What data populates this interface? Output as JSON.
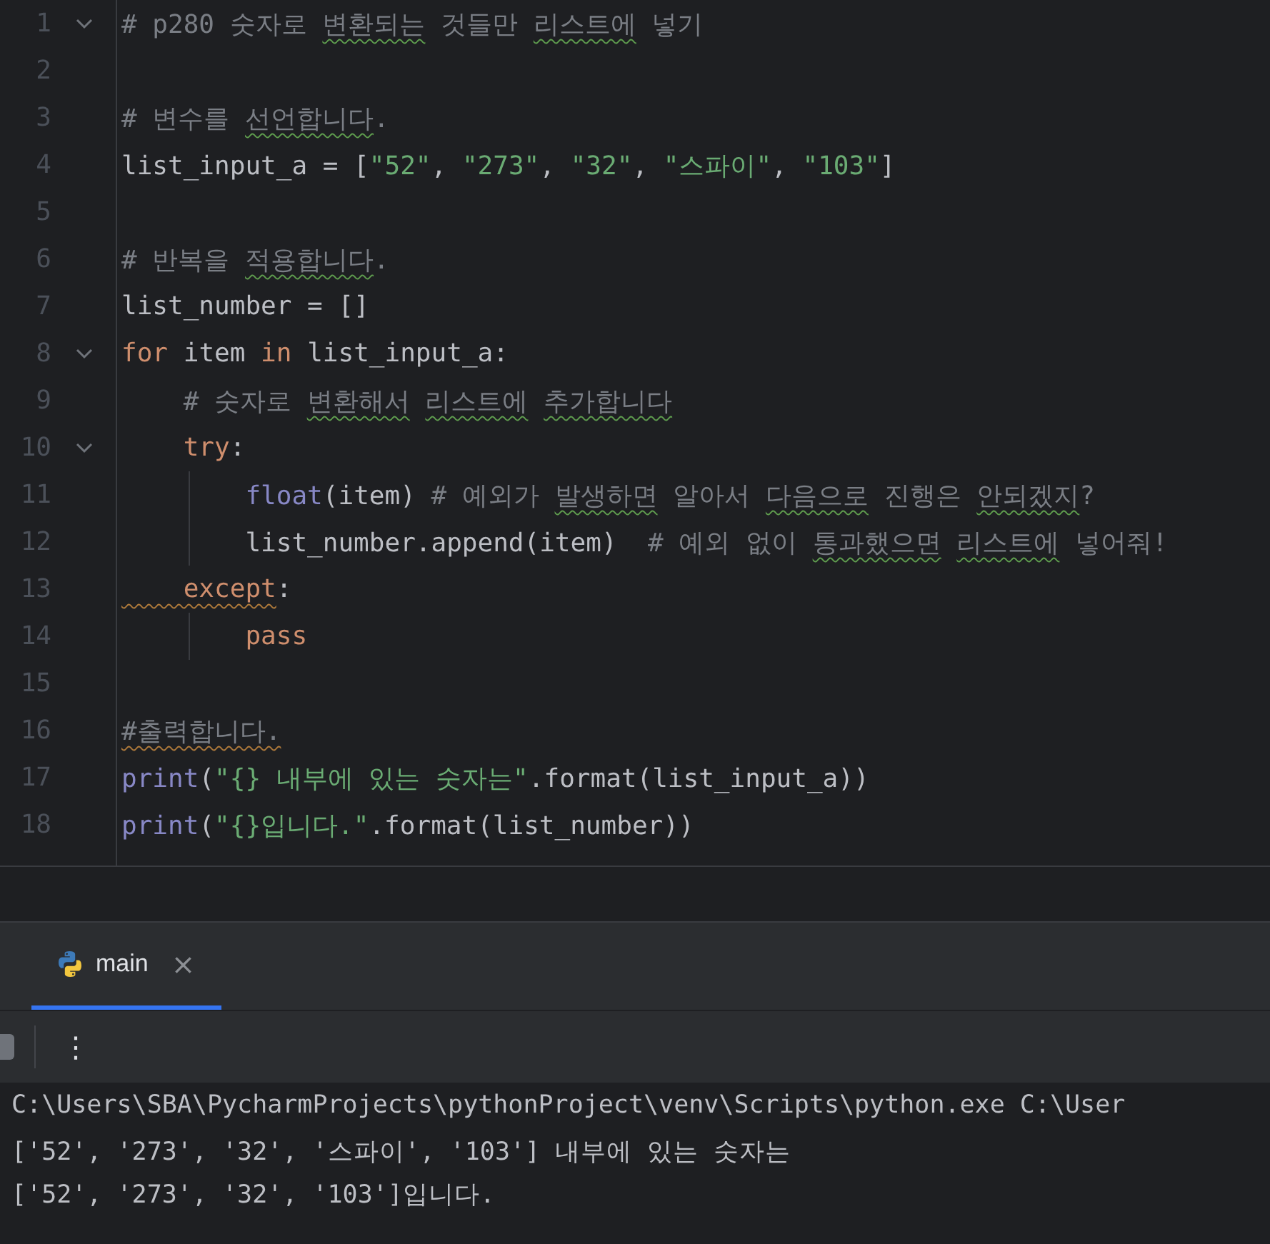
{
  "editor": {
    "lines": [
      {
        "number": "1",
        "fold": true,
        "tokens": [
          {
            "kind": "comment",
            "text": "# p280 숫자로 "
          },
          {
            "kind": "comment",
            "text": "변환되는 ",
            "typo": true
          },
          {
            "kind": "comment",
            "text": "것들만 "
          },
          {
            "kind": "comment",
            "text": "리스트에 ",
            "typo": true
          },
          {
            "kind": "comment",
            "text": "넣기"
          }
        ]
      },
      {
        "number": "2",
        "fold": false
      },
      {
        "number": "3",
        "fold": false,
        "tokens": [
          {
            "kind": "comment",
            "text": "# 변수를 "
          },
          {
            "kind": "comment",
            "text": "선언합니다",
            "typo": true
          },
          {
            "kind": "comment",
            "text": "."
          }
        ]
      },
      {
        "number": "4",
        "fold": false,
        "tokens": [
          {
            "kind": "plain",
            "text": "list_input_a = ["
          },
          {
            "kind": "string",
            "text": "\"52\""
          },
          {
            "kind": "plain",
            "text": ", "
          },
          {
            "kind": "string",
            "text": "\"273\""
          },
          {
            "kind": "plain",
            "text": ", "
          },
          {
            "kind": "string",
            "text": "\"32\""
          },
          {
            "kind": "plain",
            "text": ", "
          },
          {
            "kind": "string",
            "text": "\"스파이\""
          },
          {
            "kind": "plain",
            "text": ", "
          },
          {
            "kind": "string",
            "text": "\"103\""
          },
          {
            "kind": "plain",
            "text": "]"
          }
        ]
      },
      {
        "number": "5",
        "fold": false
      },
      {
        "number": "6",
        "fold": false,
        "tokens": [
          {
            "kind": "comment",
            "text": "# 반복을 "
          },
          {
            "kind": "comment",
            "text": "적용합니다",
            "typo": true
          },
          {
            "kind": "comment",
            "text": "."
          }
        ]
      },
      {
        "number": "7",
        "fold": false,
        "tokens": [
          {
            "kind": "plain",
            "text": "list_number = []"
          }
        ]
      },
      {
        "number": "8",
        "fold": true,
        "tokens": [
          {
            "kind": "keyword",
            "text": "for"
          },
          {
            "kind": "plain",
            "text": " item "
          },
          {
            "kind": "keyword",
            "text": "in"
          },
          {
            "kind": "plain",
            "text": " list_input_a:"
          }
        ]
      },
      {
        "number": "9",
        "fold": false,
        "tokens": [
          {
            "kind": "comment",
            "text": "    # 숫자로 "
          },
          {
            "kind": "comment",
            "text": "변환해서 ",
            "typo": true
          },
          {
            "kind": "comment",
            "text": "리스트에 ",
            "typo": true
          },
          {
            "kind": "comment",
            "text": "추가합니다",
            "typo": true
          }
        ]
      },
      {
        "number": "10",
        "fold": true,
        "tokens": [
          {
            "kind": "keyword",
            "text": "    try"
          },
          {
            "kind": "plain",
            "text": ":"
          }
        ]
      },
      {
        "number": "11",
        "fold": false,
        "tokens": [
          {
            "kind": "builtin",
            "text": "        float"
          },
          {
            "kind": "plain",
            "text": "(item) "
          },
          {
            "kind": "comment",
            "text": "# 예외가 "
          },
          {
            "kind": "comment",
            "text": "발생하면 ",
            "typo": true
          },
          {
            "kind": "comment",
            "text": "알아서 "
          },
          {
            "kind": "comment",
            "text": "다음으로 ",
            "typo": true
          },
          {
            "kind": "comment",
            "text": "진행은 "
          },
          {
            "kind": "comment",
            "text": "안되겠지",
            "typo": true
          },
          {
            "kind": "comment",
            "text": "?"
          }
        ]
      },
      {
        "number": "12",
        "fold": false,
        "tokens": [
          {
            "kind": "plain",
            "text": "        list_number.append(item)  "
          },
          {
            "kind": "comment",
            "text": "# 예외 없이 "
          },
          {
            "kind": "comment",
            "text": "통과했으면 ",
            "typo": true
          },
          {
            "kind": "comment",
            "text": "리스트에 ",
            "typo": true
          },
          {
            "kind": "comment",
            "text": "넣어줘!"
          }
        ]
      },
      {
        "number": "13",
        "fold": false,
        "tokens": [
          {
            "kind": "keyword",
            "text": "    except",
            "warning": true
          },
          {
            "kind": "plain",
            "text": ":"
          }
        ]
      },
      {
        "number": "14",
        "fold": false,
        "tokens": [
          {
            "kind": "keyword",
            "text": "        pass"
          }
        ]
      },
      {
        "number": "15",
        "fold": false
      },
      {
        "number": "16",
        "fold": false,
        "tokens": [
          {
            "kind": "comment",
            "text": "#출력합니다.",
            "warning": true
          }
        ]
      },
      {
        "number": "17",
        "fold": false,
        "tokens": [
          {
            "kind": "builtin",
            "text": "print"
          },
          {
            "kind": "plain",
            "text": "("
          },
          {
            "kind": "string",
            "text": "\"{} 내부에 있는 숫자는\""
          },
          {
            "kind": "plain",
            "text": ".format(list_input_a))"
          }
        ]
      },
      {
        "number": "18",
        "fold": false,
        "tokens": [
          {
            "kind": "builtin",
            "text": "print"
          },
          {
            "kind": "plain",
            "text": "("
          },
          {
            "kind": "string",
            "text": "\"{}입니다.\""
          },
          {
            "kind": "plain",
            "text": ".format(list_number))"
          }
        ]
      }
    ]
  },
  "run_panel": {
    "tabs": [
      {
        "label": "main",
        "selected": true,
        "close": "×"
      }
    ],
    "toolbar": {
      "more": "⋮"
    },
    "console": {
      "lines": [
        "C:\\Users\\SBA\\PycharmProjects\\pythonProject\\venv\\Scripts\\python.exe C:\\User",
        "['52', '273', '32', '스파이', '103'] 내부에 있는 숫자는",
        "['52', '273', '32', '103']입니다."
      ]
    }
  }
}
